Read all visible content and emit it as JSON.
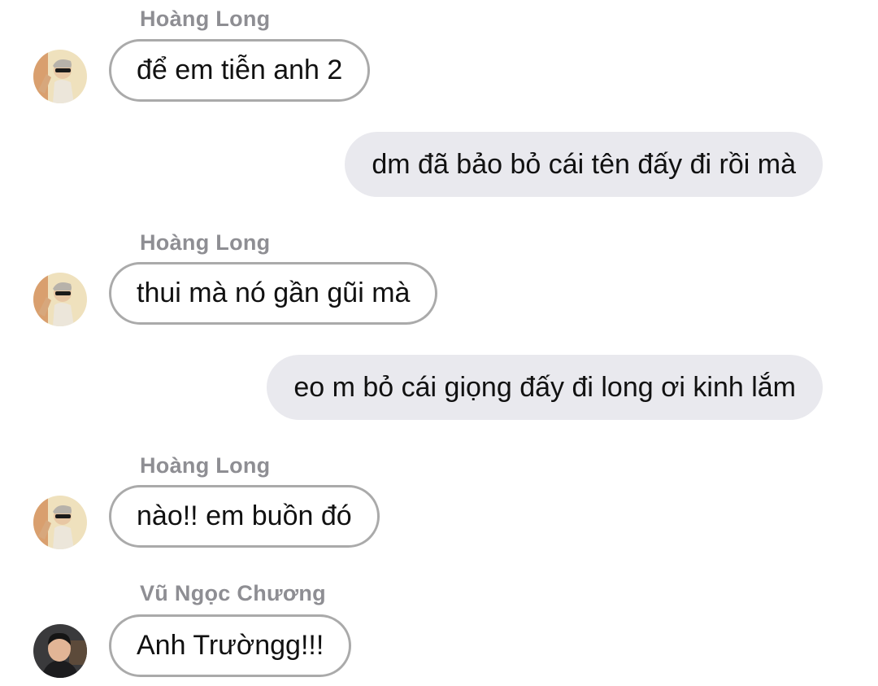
{
  "messages": [
    {
      "sender": "Hoàng Long",
      "text": "để em tiễn anh 2",
      "direction": "incoming",
      "avatar": "avatar-hoang-long"
    },
    {
      "text": "dm đã bảo bỏ cái tên đấy đi rồi mà",
      "direction": "outgoing"
    },
    {
      "sender": "Hoàng Long",
      "text": "thui mà nó gần gũi mà",
      "direction": "incoming",
      "avatar": "avatar-hoang-long"
    },
    {
      "text": "eo m bỏ cái giọng đấy đi long ơi kinh lắm",
      "direction": "outgoing"
    },
    {
      "sender": "Hoàng Long",
      "text": "nào!! em buồn đó",
      "direction": "incoming",
      "avatar": "avatar-hoang-long"
    },
    {
      "sender": "Vũ Ngọc Chương",
      "text": "Anh Trườngg!!!",
      "direction": "incoming",
      "avatar": "avatar-vu-ngoc-chuong"
    }
  ],
  "colors": {
    "incoming_bubble_border": "#aaaaaa",
    "outgoing_bubble_bg": "#e9e9ee",
    "sender_name": "#8e8e93"
  }
}
